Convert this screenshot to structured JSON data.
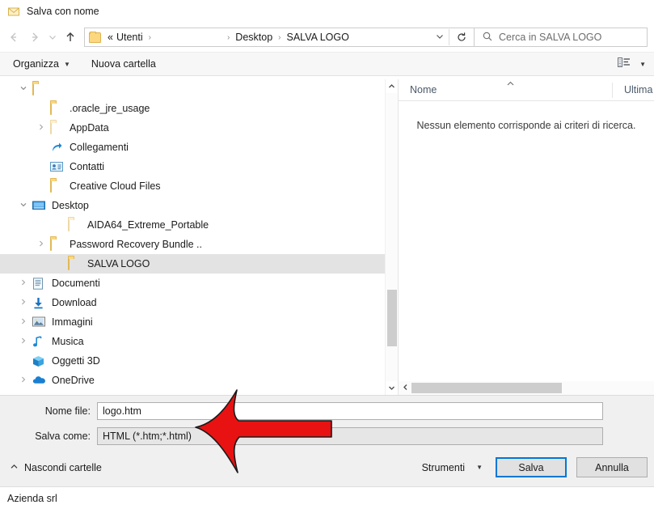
{
  "window": {
    "title": "Salva con nome",
    "title_icon": "mail-envelope-icon"
  },
  "nav": {
    "back_icon": "arrow-left-icon",
    "forward_icon": "arrow-right-icon",
    "recent_icon": "chevron-down-icon",
    "up_icon": "arrow-up-icon",
    "refresh_icon": "refresh-icon",
    "dropdown_icon": "chevron-down-icon"
  },
  "address": {
    "folder_icon": "folder-icon",
    "crumbs": [
      {
        "label": "«",
        "type": "overflow"
      },
      {
        "label": "Utenti",
        "type": "crumb"
      },
      {
        "label": "",
        "type": "redacted"
      },
      {
        "label": "Desktop",
        "type": "crumb"
      },
      {
        "label": "SALVA LOGO",
        "type": "crumb"
      }
    ],
    "separator": "›"
  },
  "search": {
    "icon": "search-icon",
    "placeholder": "Cerca in SALVA LOGO",
    "value": ""
  },
  "toolbar": {
    "organize_label": "Organizza",
    "new_folder_label": "Nuova cartella",
    "view_icon": "list-view-icon",
    "view_caret_icon": "chevron-down-icon",
    "help_icon": "help-icon"
  },
  "tree": {
    "items": [
      {
        "label": "",
        "icon": "folder-icon",
        "indent": 1,
        "expander": "v",
        "redacted": true,
        "selected": false
      },
      {
        "label": ".oracle_jre_usage",
        "icon": "folder-icon",
        "indent": 2,
        "expander": "",
        "selected": false
      },
      {
        "label": "AppData",
        "icon": "folder-pale-icon",
        "indent": 2,
        "expander": ">",
        "selected": false
      },
      {
        "label": "Collegamenti",
        "icon": "shortcut-icon",
        "indent": 2,
        "expander": "",
        "selected": false
      },
      {
        "label": "Contatti",
        "icon": "contacts-icon",
        "indent": 2,
        "expander": "",
        "selected": false
      },
      {
        "label": "Creative Cloud Files",
        "icon": "folder-icon",
        "indent": 2,
        "expander": "",
        "selected": false
      },
      {
        "label": "Desktop",
        "icon": "desktop-icon",
        "indent": 1,
        "expander": "v",
        "selected": false
      },
      {
        "label": "AIDA64_Extreme_Portable",
        "icon": "folder-pale-icon",
        "indent": 3,
        "expander": "",
        "selected": false
      },
      {
        "label": "Password Recovery Bundle ..",
        "icon": "folder-icon",
        "indent": 2,
        "expander": ">",
        "selected": false
      },
      {
        "label": "SALVA LOGO",
        "icon": "folder-icon",
        "indent": 3,
        "expander": "",
        "selected": true
      },
      {
        "label": "Documenti",
        "icon": "documents-icon",
        "indent": 1,
        "expander": ">",
        "selected": false
      },
      {
        "label": "Download",
        "icon": "download-icon",
        "indent": 1,
        "expander": ">",
        "selected": false
      },
      {
        "label": "Immagini",
        "icon": "pictures-icon",
        "indent": 1,
        "expander": ">",
        "selected": false
      },
      {
        "label": "Musica",
        "icon": "music-icon",
        "indent": 1,
        "expander": ">",
        "selected": false
      },
      {
        "label": "Oggetti 3D",
        "icon": "3d-objects-icon",
        "indent": 1,
        "expander": "",
        "selected": false
      },
      {
        "label": "OneDrive",
        "icon": "onedrive-icon",
        "indent": 1,
        "expander": ">",
        "selected": false
      }
    ]
  },
  "filelist": {
    "columns": [
      {
        "label": "Nome",
        "sorted": true,
        "sort_icon": "chevron-up-icon"
      },
      {
        "label": "Ultima",
        "sorted": false,
        "sort_icon": ""
      }
    ],
    "empty_message": "Nessun elemento corrisponde ai criteri di ricerca."
  },
  "form": {
    "filename_label": "Nome file:",
    "filename_value": "logo.htm",
    "savetype_label": "Salva come:",
    "savetype_value": "HTML (*.htm;*.html)"
  },
  "buttons": {
    "hide_folders_label": "Nascondi cartelle",
    "hide_folders_icon": "chevron-up-icon",
    "tools_label": "Strumenti",
    "tools_caret_icon": "chevron-down-icon",
    "save_label": "Salva",
    "cancel_label": "Annulla"
  },
  "statusbar": {
    "text": "Azienda srl"
  },
  "annotation": {
    "type": "red-arrow-left",
    "fill_color": "#e81212",
    "stroke_color": "#1a1a1a",
    "points_at": "savetype_value"
  },
  "scrollbars": {
    "tree_up_icon": "chevron-up-icon",
    "tree_down_icon": "chevron-down-icon",
    "file_left_icon": "chevron-left-icon"
  }
}
